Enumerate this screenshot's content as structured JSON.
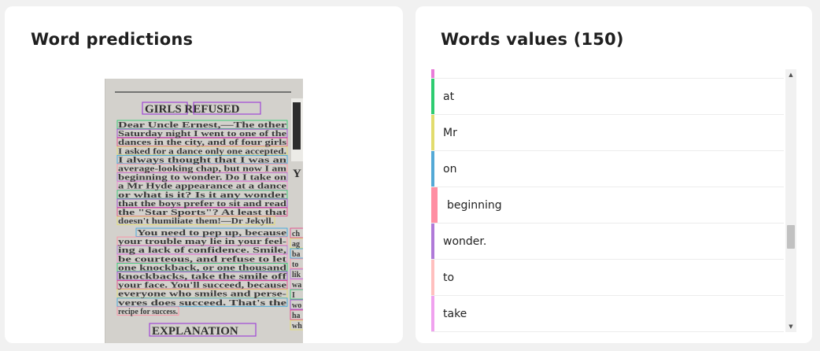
{
  "left_panel": {
    "title": "Word predictions",
    "document": {
      "headline": "GIRLS  REFUSED",
      "lines": [
        "Dear  Uncle  Ernest,—The  other",
        "Saturday night I went to one of the",
        "dances in the city, and of four girls",
        "I asked for a dance only one accepted.",
        "I  always  thought  that  I  was  an",
        "average-looking  chap,  but  now  I  am",
        "beginning to wonder.  Do I take on",
        "a  Mr  Hyde  appearance  at  a  dance",
        "or  what  is  it?  Is  it  any  wonder",
        "that the boys prefer to sit and read",
        "the  \"Star  Sports\"?  At  least  that",
        "doesn't  humiliate  them!—Dr Jekyll.",
        "You  need  to  pep  up,  because",
        "your trouble may lie in your feel-",
        "ing a lack of confidence.  Smile,",
        "be  courteous,  and  refuse  to  let",
        "one  knockback,  or  one  thousand",
        "knockbacks,  take  the  smile  off",
        "your face. You'll succeed, because",
        "everyone  who  smiles  and  perse-",
        "veres  does  succeed.  That's  the",
        "recipe  for  success."
      ],
      "footer": "EXPLANATION",
      "side_fragments": [
        "ch",
        "ag",
        "ba",
        "to",
        "lik",
        "wa",
        "I",
        "wo",
        "ha",
        "wh"
      ]
    }
  },
  "right_panel": {
    "title": "Words values (150)",
    "words": [
      {
        "label": "at",
        "color": "#2ecc71"
      },
      {
        "label": "Mr",
        "color": "#e2dc6e"
      },
      {
        "label": "on",
        "color": "#54a9d6"
      },
      {
        "label": "beginning",
        "color": "#ff8fa3"
      },
      {
        "label": "wonder.",
        "color": "#b07ad8"
      },
      {
        "label": "to",
        "color": "#ffc0bf"
      },
      {
        "label": "take",
        "color": "#f0a2ef"
      }
    ],
    "top_partial_color": "#e97bd9",
    "scrollbar": {
      "up_arrow": "▲",
      "down_arrow": "▼"
    }
  }
}
